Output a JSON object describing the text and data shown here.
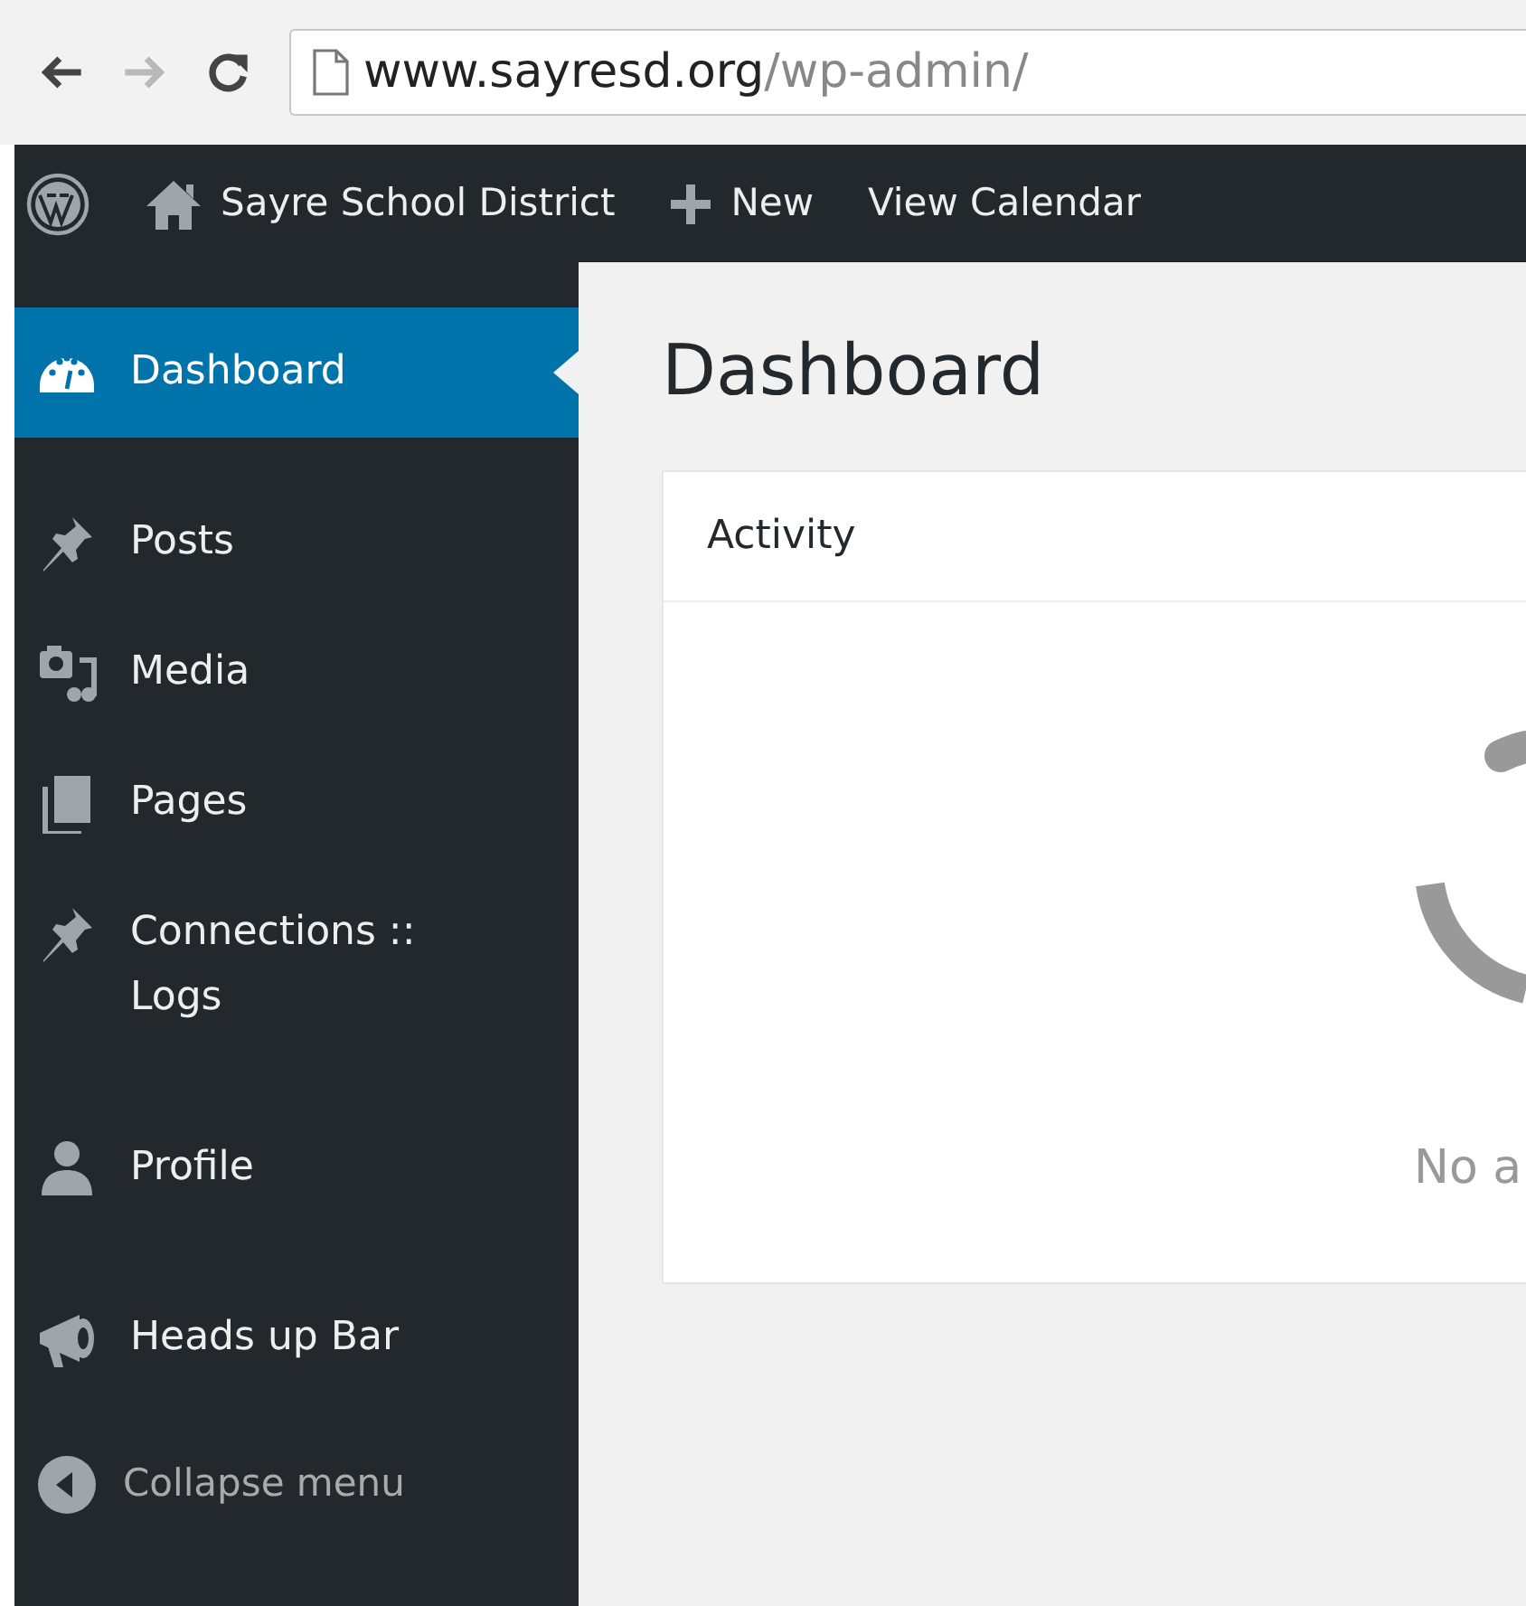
{
  "browser": {
    "buttons": [
      {
        "kind": "back",
        "disabled": false
      },
      {
        "kind": "forward",
        "disabled": true
      },
      {
        "kind": "reload",
        "disabled": false
      }
    ],
    "address": {
      "host": "www.sayresd.org",
      "path": "/wp-admin/"
    }
  },
  "admin_bar": {
    "items": [
      {
        "kind": "logo"
      },
      {
        "kind": "site",
        "label": "Sayre School District"
      },
      {
        "kind": "new",
        "label": "New"
      },
      {
        "kind": "link",
        "label": "View Calendar"
      }
    ]
  },
  "sidebar": {
    "groups": [
      [
        {
          "label": "Dashboard",
          "selected": true
        }
      ],
      [
        {
          "label": "Posts",
          "selected": false
        },
        {
          "label": "Media",
          "selected": false
        },
        {
          "label": "Pages",
          "selected": false
        },
        {
          "label": "Connections :: Logs",
          "selected": false
        }
      ],
      [
        {
          "label": "Profile",
          "selected": false
        }
      ],
      [
        {
          "label": "Heads up Bar",
          "selected": false
        }
      ]
    ],
    "collapse": {
      "label": "Collapse menu"
    }
  },
  "main": {
    "title": "Dashboard",
    "widget": {
      "title": "Activity",
      "message": "No a"
    }
  }
}
